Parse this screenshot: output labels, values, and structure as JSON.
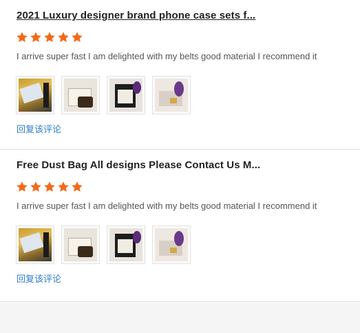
{
  "reviews": [
    {
      "title": "2021 Luxury designer brand phone case sets f...",
      "rating": 5,
      "text": "I arrive super fast I am delighted with my belts good material I recommend it",
      "images": [
        "product-photo-1",
        "product-photo-2",
        "product-photo-3",
        "product-photo-4"
      ],
      "reply_label": "回复该评论"
    },
    {
      "title": "Free Dust Bag All designs Please Contact Us M...",
      "rating": 5,
      "text": "I arrive super fast I am delighted with my belts good material I recommend it",
      "images": [
        "product-photo-1",
        "product-photo-2",
        "product-photo-3",
        "product-photo-4"
      ],
      "reply_label": "回复该评论"
    }
  ],
  "colors": {
    "star": "#f26a1b",
    "link": "#2f7ecb",
    "divider": "#dcdcdc"
  },
  "icons": {
    "star": "star-icon"
  }
}
